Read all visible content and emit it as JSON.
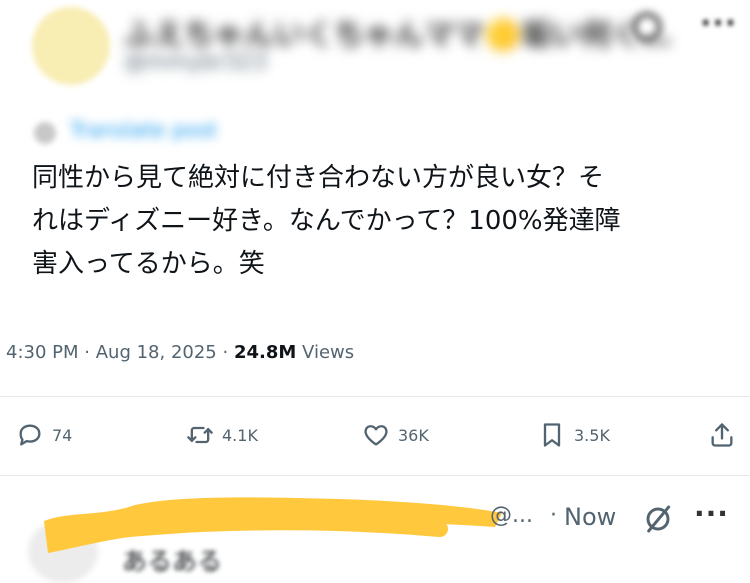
{
  "author": {
    "display_name": "ふえちゃんいくちゃんママ🟡垢い何く…",
    "handle": "@mmybr323"
  },
  "translate_label": "Translate post",
  "tweet": {
    "text": "同性から見て絶対に付き合わない方が良い女？そ\nれはディズニー好き。なんでかって？100%発達障\n害入ってるから。笑",
    "time": "4:30 PM",
    "separator": "·",
    "date": "Aug 18, 2025",
    "views_count": "24.8M",
    "views_label": "Views"
  },
  "actions": {
    "reply_count": "74",
    "retweet_count": "4.1K",
    "like_count": "36K",
    "bookmark_count": "3.5K"
  },
  "reply": {
    "handle": "@...",
    "separator": "·",
    "time": "Now",
    "text": "あるある"
  },
  "colors": {
    "accent": "#1d9bf0",
    "muted": "#536471",
    "scribble": "#ffc83d"
  }
}
